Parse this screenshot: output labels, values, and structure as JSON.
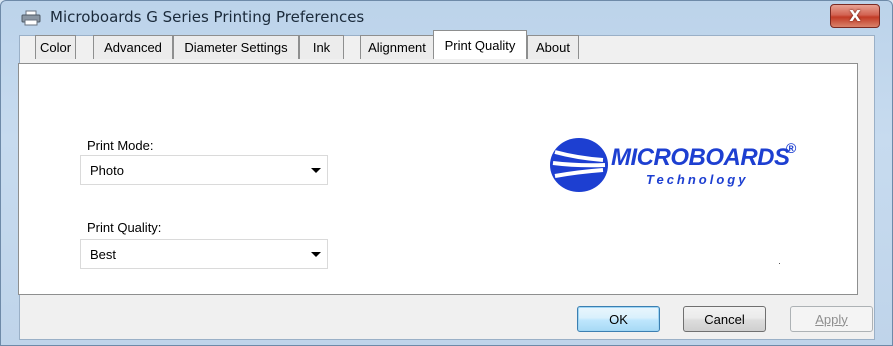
{
  "window": {
    "title": "Microboards G Series Printing Preferences",
    "close_label": "X"
  },
  "tabs": [
    {
      "label": "Color"
    },
    {
      "label": "Advanced"
    },
    {
      "label": "Diameter Settings"
    },
    {
      "label": "Ink"
    },
    {
      "label": "Alignment"
    },
    {
      "label": "Print Quality",
      "active": true
    },
    {
      "label": "About"
    }
  ],
  "print_quality_panel": {
    "print_mode": {
      "label": "Print Mode:",
      "value": "Photo"
    },
    "print_quality": {
      "label": "Print Quality:",
      "value": "Best"
    }
  },
  "logo": {
    "brand": "MICROBOARDS",
    "registered": "®",
    "subtitle": "Technology",
    "color": "#1d3fd1"
  },
  "buttons": {
    "ok": "OK",
    "cancel": "Cancel",
    "apply": "Apply"
  }
}
